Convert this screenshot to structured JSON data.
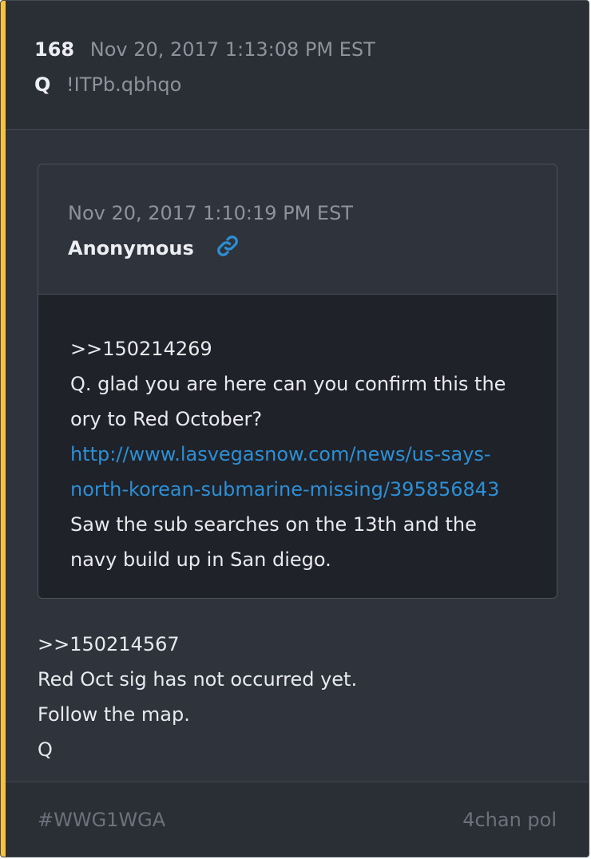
{
  "post": {
    "number": "168",
    "timestamp": "Nov 20, 2017 1:13:08 PM EST",
    "author": "Q",
    "tripcode": "!ITPb.qbhqo"
  },
  "quoted_post": {
    "timestamp": "Nov 20, 2017 1:10:19 PM EST",
    "author": "Anonymous",
    "link_icon": "link-icon",
    "lines": [
      ">>150214269",
      "Q. glad you are here can you confirm this the",
      "ory to Red October?"
    ],
    "url_lines": [
      "http://www.lasvegasnow.com/news/us-says-",
      "north-korean-submarine-missing/395856843"
    ],
    "trailing_lines": [
      "Saw the sub searches on the 13th and the",
      "navy build up in San diego."
    ]
  },
  "reply": {
    "lines": [
      ">>150214567",
      "Red Oct sig has not occurred yet.",
      "Follow the map.",
      "Q"
    ]
  },
  "footer": {
    "hashtag": "#WWG1WGA",
    "source": "4chan pol"
  },
  "colors": {
    "accent": "#f5c242",
    "link": "#2d8fd5",
    "background": "#2e333c"
  }
}
